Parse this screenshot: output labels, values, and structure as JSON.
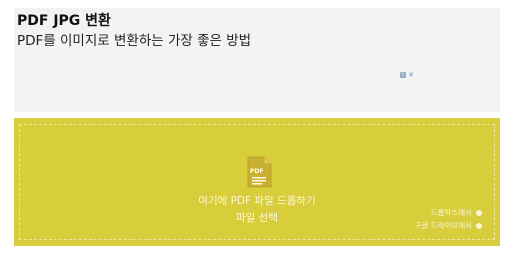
{
  "ad": {
    "title": "PDF JPG 변환",
    "subtitle": "PDF를 이미지로 변환하는 가장 좋은 방법",
    "badge_icons": [
      "ad-info-icon",
      "ad-close-icon"
    ]
  },
  "dropzone": {
    "drop_label": "여기에 PDF 파일 드롭하기",
    "choose_label": "파일 선택",
    "file_icon": "pdf-file-icon",
    "file_icon_text": "PDF",
    "background_color": "#d8cd3a",
    "sources": [
      {
        "label": "드롭박스에서",
        "icon": "dropbox-icon"
      },
      {
        "label": "구글 드라이브에서",
        "icon": "google-drive-icon"
      }
    ]
  }
}
